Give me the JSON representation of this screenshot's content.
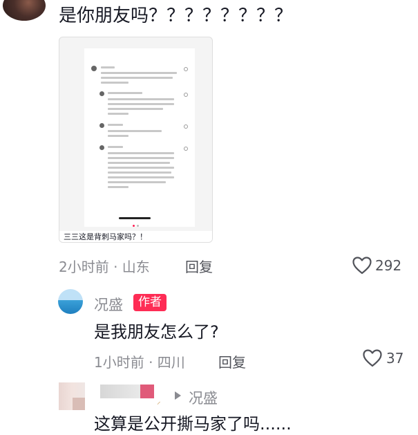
{
  "top_comment": {
    "text": "是你朋友吗？？？？？？？？",
    "card_caption": "三三这是背刺马家吗？！",
    "time_location": "2小时前 · 山东",
    "reply_label": "回复",
    "like_count": "292"
  },
  "author_reply": {
    "username": "况盛",
    "author_tag": "作者",
    "text": "是我朋友怎么了?",
    "time_location": "1小时前 · 四川",
    "reply_label": "回复",
    "like_count": "37"
  },
  "third_comment": {
    "reply_to": "况盛",
    "text": "这算是公开撕马家了吗......"
  },
  "colors": {
    "accent": "#fe2c55",
    "meta_gray": "#8a8b91",
    "text": "#161823"
  }
}
